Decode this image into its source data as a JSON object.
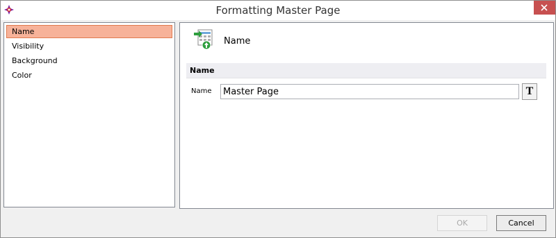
{
  "window": {
    "title": "Formatting Master Page"
  },
  "sidebar": {
    "items": [
      {
        "label": "Name"
      },
      {
        "label": "Visibility"
      },
      {
        "label": "Background"
      },
      {
        "label": "Color"
      }
    ],
    "selected_color": "#f7b299"
  },
  "main": {
    "header": "Name",
    "section_title": "Name",
    "field": {
      "label": "Name",
      "value": "Master Page"
    },
    "text_button_label": "T"
  },
  "footer": {
    "ok_label": "OK",
    "cancel_label": "Cancel"
  },
  "icons": {
    "app": "app-logo-icon",
    "close": "close-icon",
    "page": "master-page-icon"
  }
}
